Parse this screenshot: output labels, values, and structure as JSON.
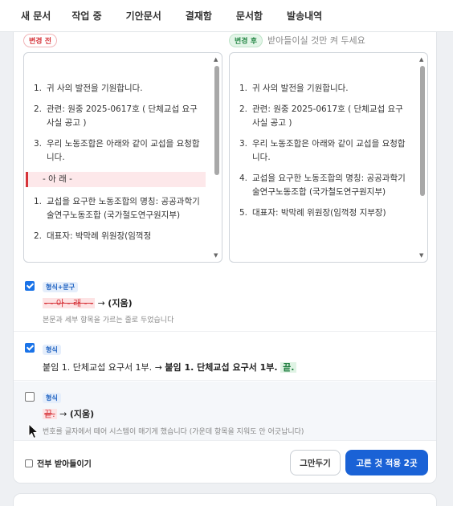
{
  "nav": {
    "items": [
      "새 문서",
      "작업 중",
      "기안문서",
      "결재함",
      "문서함",
      "발송내역"
    ]
  },
  "diff": {
    "before_label": "변경 전",
    "after_label": "변경 후",
    "hint": "받아들이실 것만 켜 두세요",
    "before": {
      "items": [
        {
          "num": "1.",
          "text": "귀 사의 발전을 기원합니다."
        },
        {
          "num": "2.",
          "text": "관련: 원중 2025-0617호 ( 단체교섭 요구사실 공고 )"
        },
        {
          "num": "3.",
          "text": "우리 노동조합은 아래와 같이 교섭을 요청합니다."
        }
      ],
      "divider": "- 아 래 -",
      "items_after": [
        {
          "num": "1.",
          "text": "교섭을 요구한 노동조합의 명칭: 공공과학기술연구노동조합 (국가철도연구원지부)"
        },
        {
          "num": "2.",
          "text": "대표자: 박막례 위원장(임꺽정"
        }
      ]
    },
    "after": {
      "items": [
        {
          "num": "1.",
          "text": "귀 사의 발전을 기원합니다."
        },
        {
          "num": "2.",
          "text": "관련: 원중 2025-0617호 ( 단체교섭 요구사실 공고 )"
        },
        {
          "num": "3.",
          "text": "우리 노동조합은 아래와 같이 교섭을 요청합니다."
        },
        {
          "num": "4.",
          "text": "교섭을 요구한 노동조합의 명칭: 공공과학기술연구노동조합 (국가철도연구원지부)"
        },
        {
          "num": "5.",
          "text": "대표자: 박막례 위원장(임꺽정 지부장)"
        }
      ]
    }
  },
  "changes": [
    {
      "checked": true,
      "tag": "형식+문구",
      "deleted": "- - 아 - 래 - -",
      "arrow": "→",
      "result": "(지움)",
      "description": "본문과 세부 항목을 가르는 줄로 두었습니다"
    },
    {
      "checked": true,
      "tag": "형식",
      "original": "붙임 1. 단체교섭 요구서 1부.",
      "arrow": "→",
      "replaced": "붙임 1. 단체교섭 요구서 1부.",
      "inserted": "끝."
    },
    {
      "checked": false,
      "tag": "형식",
      "deleted": "끝.",
      "arrow": "→",
      "result": "(지움)",
      "description": "번호를 글자에서 떼어 시스템이 매기게 했습니다 (가운데 항목을 지워도 안 어긋납니다)"
    }
  ],
  "footer": {
    "accept_all": "전부 받아들이기",
    "cancel": "그만두기",
    "apply": "고른 것 적용 2곳"
  },
  "colors": {
    "primary": "#1a62d6",
    "deleted": "#d6343a",
    "inserted": "#1e7d3e"
  }
}
